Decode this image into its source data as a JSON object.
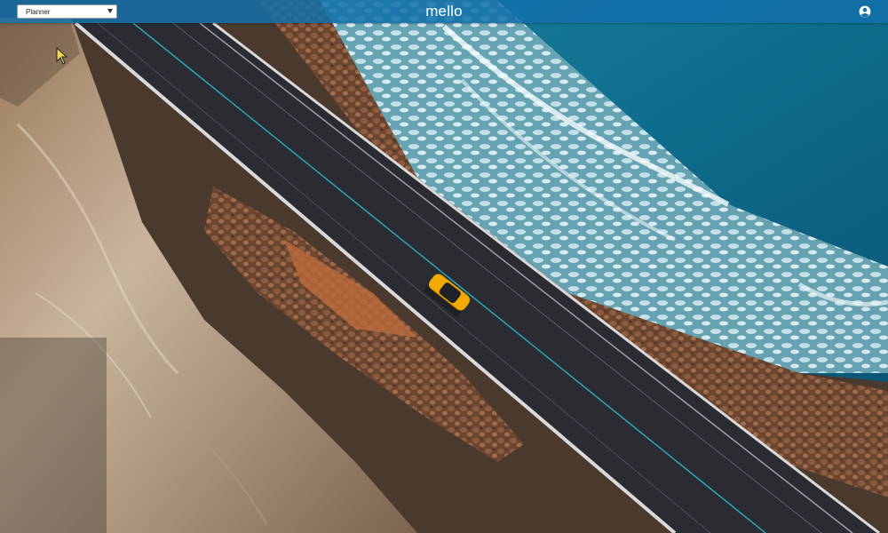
{
  "header": {
    "board_select": {
      "selected": "Planner"
    },
    "title": "mello",
    "user_icon": "account-circle-icon"
  },
  "background": {
    "description_icon": "coastal-road-aerial-photo"
  },
  "colors": {
    "header": "#1270AA",
    "sea": "#0E6C8C",
    "road": "#2B2D31",
    "car": "#F2A900",
    "rocks": "#8A5A3C",
    "cliff": "#C8B49C"
  }
}
